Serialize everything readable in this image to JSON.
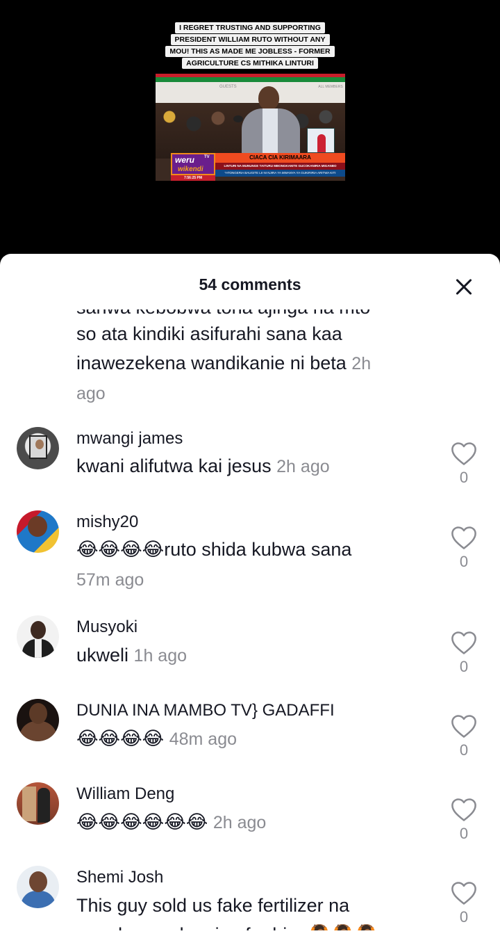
{
  "video": {
    "headline_lines": [
      "I REGRET TRUSTING AND SUPPORTING",
      "PRESIDENT WILLIAM RUTO WITHOUT ANY",
      "MOU! THIS AS MADE ME JOBLESS - FORMER",
      "AGRICULTURE CS MITHIKA LINTURI"
    ],
    "thumbnail": {
      "banner_left": "GUESTS",
      "banner_right": "ALL MEMBERS",
      "logo_top": "weru",
      "logo_tv": "TV",
      "logo_bottom": "wikendi",
      "time": "7:56:25 PM",
      "headline": "CIACA CIA KIRIMAARA",
      "subheadline": "LINTURI NA MUNUNGE TAITURU MBONGKANITE GUCOKANIRIA MIGANBO",
      "ticker": "*ATONGERIA BAUGITE LII NI NJIRA YA MWANYA YA GUKIRIRIA ARITWA KITI"
    }
  },
  "sheet": {
    "comment_count": "54 comments",
    "close_icon": "close-icon"
  },
  "comments": [
    {
      "partial_top": "sanwa kebobwa tona ajinga na mto",
      "text_lines": [
        "so ata kindiki asifurahi sana kaa",
        "inawezekena wandikanie ni beta"
      ],
      "time": "2h",
      "time_tail": "ago",
      "likes": "0"
    },
    {
      "username": "mwangi james",
      "text": "kwani alifutwa kai jesus",
      "time": "2h ago",
      "likes": "0"
    },
    {
      "username": "mishy20",
      "emojis": "😂😂😂😂",
      "text": "ruto shida kubwa sana",
      "time": "57m ago",
      "likes": "0"
    },
    {
      "username": "Musyoki",
      "text": "ukweli",
      "time": "1h ago",
      "likes": "0"
    },
    {
      "username": "DUNIA INA MAMBO TV} GADAFFI",
      "emojis": "😂😂😂😂",
      "time": "48m ago",
      "likes": "0"
    },
    {
      "username": "William Deng",
      "emojis": "😂😂😂😂😂😂",
      "time": "2h ago",
      "likes": "0"
    },
    {
      "username": "Shemi Josh",
      "text": "This guy sold us fake fertilizer na",
      "text_cut": "people are clapping for him 🙆🏾🙆🏾🙆🏾",
      "likes": "0"
    }
  ],
  "colors": {
    "text": "#161823",
    "muted": "#8a8b91",
    "sheet_bg": "#ffffff",
    "video_bg": "#000000"
  }
}
